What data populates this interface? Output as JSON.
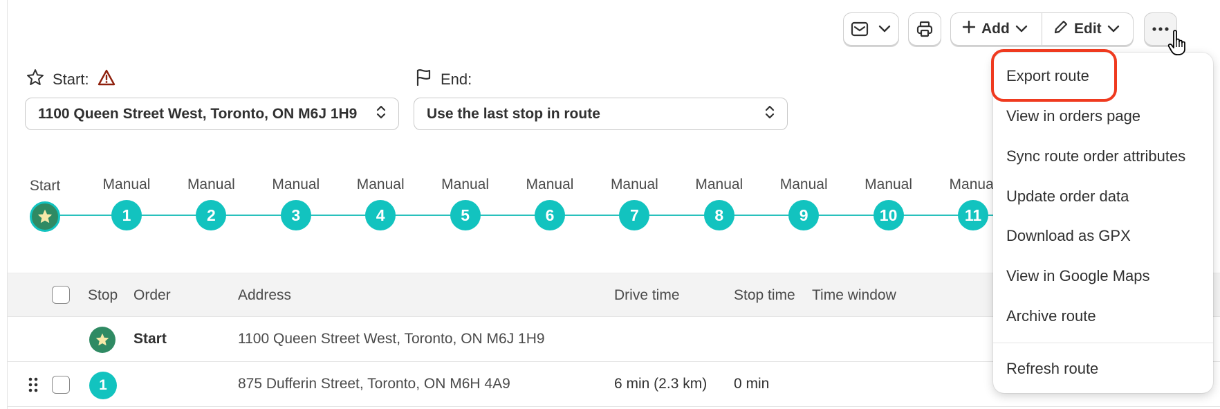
{
  "toolbar": {
    "email_icon": "envelope-icon",
    "print_icon": "printer-icon",
    "add_label": "Add",
    "edit_label": "Edit",
    "more_icon": "ellipsis-icon"
  },
  "route": {
    "start_label": "Start:",
    "start_value": "1100 Queen Street West, Toronto, ON M6J 1H9",
    "end_label": "End:",
    "end_value": "Use the last stop in route"
  },
  "timeline": {
    "start_label": "Start",
    "stops": [
      {
        "label": "Manual",
        "number": "1"
      },
      {
        "label": "Manual",
        "number": "2"
      },
      {
        "label": "Manual",
        "number": "3"
      },
      {
        "label": "Manual",
        "number": "4"
      },
      {
        "label": "Manual",
        "number": "5"
      },
      {
        "label": "Manual",
        "number": "6"
      },
      {
        "label": "Manual",
        "number": "7"
      },
      {
        "label": "Manual",
        "number": "8"
      },
      {
        "label": "Manual",
        "number": "9"
      },
      {
        "label": "Manual",
        "number": "10"
      },
      {
        "label": "Manual",
        "number": "11"
      }
    ]
  },
  "table": {
    "headers": {
      "stop": "Stop",
      "order": "Order",
      "address": "Address",
      "drive_time": "Drive time",
      "stop_time": "Stop time",
      "time_window": "Time window"
    },
    "rows": [
      {
        "stop": "",
        "order": "Start",
        "address": "1100 Queen Street West, Toronto, ON M6J 1H9",
        "drive_time": "",
        "stop_time": ""
      },
      {
        "stop": "1",
        "order": "",
        "address": "875 Dufferin Street, Toronto, ON M6H 4A9",
        "drive_time": "6 min (2.3 km)",
        "stop_time": "0 min"
      }
    ]
  },
  "menu": {
    "items": [
      "Export route",
      "View in orders page",
      "Sync route order attributes",
      "Update order data",
      "Download as GPX",
      "View in Google Maps",
      "Archive route"
    ],
    "footer_item": "Refresh route"
  },
  "colors": {
    "teal": "#12c3bf",
    "start_green": "#2f8a63",
    "highlight_red": "#ef3a1f",
    "warning_red": "#8e1f0b"
  }
}
